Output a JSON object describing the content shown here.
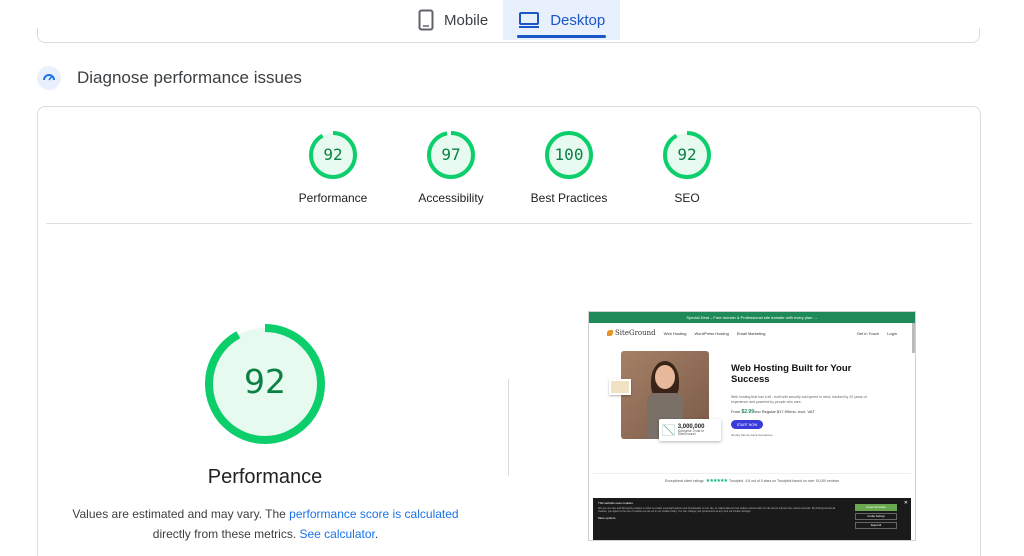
{
  "tabs": [
    {
      "label": "Mobile",
      "icon": "mobile-phone-icon",
      "active": false
    },
    {
      "label": "Desktop",
      "icon": "desktop-monitor-icon",
      "active": true
    }
  ],
  "section": {
    "title": "Diagnose performance issues",
    "icon": "diagnose-gauge-icon"
  },
  "categories": [
    {
      "score": 92,
      "label": "Performance"
    },
    {
      "score": 97,
      "label": "Accessibility"
    },
    {
      "score": 100,
      "label": "Best Practices"
    },
    {
      "score": 92,
      "label": "SEO"
    }
  ],
  "main_gauge": {
    "score": 92,
    "title": "Performance"
  },
  "note": {
    "prefix": "Values are estimated and may vary. The ",
    "link1": "performance score is calculated",
    "middle": " directly from these metrics. ",
    "link2": "See calculator",
    "suffix": "."
  },
  "screenshot": {
    "promo": "Special Deal – Free domain & Professional site transfer with every plan  →",
    "logo": "SiteGround",
    "nav": [
      "Web Hosting",
      "WordPress Hosting",
      "Email Marketing"
    ],
    "nav_right": [
      "Get in Touch",
      "Login"
    ],
    "headline": "Web Hosting Built for Your Success",
    "subtext": "Web hosting that has it all - built with security and speed in mind, backed by 20 years of experience and powered by people who care.",
    "price_label": "From",
    "price": "$2.99",
    "price_suffix": "/mo  Regular $17.99/mo. excl. VAT",
    "cta": "START NOW",
    "guarantee": "30-day Money-back Guarantee",
    "stat_number": "3,000,000",
    "stat_text": "Domains Trust in SiteGround",
    "trust": "Exceptional client ratings",
    "trust_brand": "Trustpilot",
    "trust_detail": "4.8 out of 5 stars on Trustpilot based on over 15,000 reviews",
    "cookie_title": "This website uses cookies",
    "cookie_text": "We use our own and third-party cookies in order to enable essential features and functionality on our site, to collect data on how visitors interact with our site and to improve the content and ads. By clicking Accept all cookies, you agree to the use of cookies as set out in our Cookie Policy. You can change your preferences at any time via Cookie Settings.",
    "cookie_more": "More options",
    "cookie_buttons": [
      "Accept all cookies",
      "Cookie Settings",
      "Reject All"
    ]
  },
  "colors": {
    "pass_green": "#0cce6b",
    "pass_text": "#0b8043",
    "link": "#1a73e8",
    "tab_active": "#1a56c6"
  }
}
